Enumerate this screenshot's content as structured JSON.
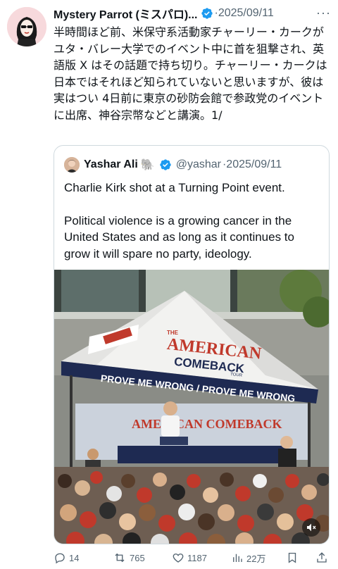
{
  "tweet": {
    "author_name": "Mystery Parrot (ミスパロ)...",
    "date": "·2025/09/11",
    "more_label": "···",
    "text": "半時間ほど前、米保守系活動家チャーリー・カークがユタ・バレー大学でのイベント中に首を狙撃され、英語版 X はその話題で持ち切り。チャーリー・カークは日本ではそれほど知られていないと思いますが、彼は実はつい 4日前に東京の砂防会館で参政党のイベントに出席、神谷宗幣などと講演。1/"
  },
  "quote": {
    "author_name": "Yashar Ali",
    "emoji": "🐘",
    "handle": "@yashar",
    "date": "·2025/09/11",
    "paragraph1": "Charlie Kirk shot at a Turning Point event.",
    "paragraph2": "Political violence is a growing cancer in the United States and as long as it continues to grow it will spare no party, ideology.",
    "media": {
      "tent_banner": "PROVE ME WRONG / PROVE ME WRONG",
      "tent_brand_line1": "THE",
      "tent_brand_line2": "AMERICAN",
      "tent_brand_line3": "COMEBACK",
      "tent_brand_line4": "TOUR",
      "stage_banner": "AMERICAN COMEBACK"
    }
  },
  "actions": {
    "replies": "14",
    "reposts": "765",
    "likes": "1187",
    "views": "22万"
  },
  "colors": {
    "verified": "#1d9bf0",
    "text_secondary": "#536471",
    "border": "#cfd9de",
    "avatar_bg": "#f7d9dc"
  }
}
